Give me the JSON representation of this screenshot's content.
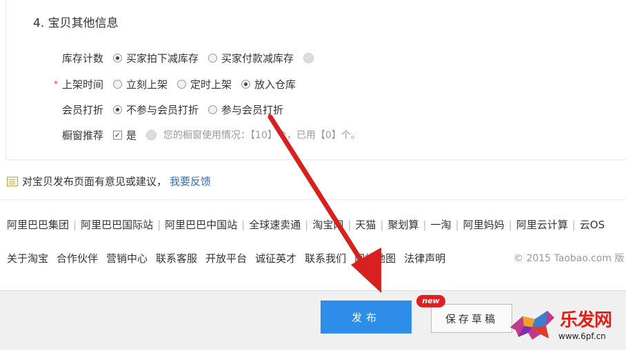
{
  "section": {
    "title": "4. 宝贝其他信息"
  },
  "form": {
    "inventory": {
      "label": "库存计数",
      "opt1": "买家拍下减库存",
      "opt2": "买家付款减库存"
    },
    "listing": {
      "label": "上架时间",
      "opt1": "立刻上架",
      "opt2": "定时上架",
      "opt3": "放入仓库"
    },
    "member": {
      "label": "会员打折",
      "opt1": "不参与会员打折",
      "opt2": "参与会员打折"
    },
    "window": {
      "label": "橱窗推荐",
      "opt1": "是",
      "usage": "您的橱窗使用情况：【10】个，已用【0】个。"
    }
  },
  "feedback": {
    "text": "对宝贝发布页面有意见或建议，",
    "link": "我要反馈"
  },
  "footer_links1": [
    "阿里巴巴集团",
    "阿里巴巴国际站",
    "阿里巴巴中国站",
    "全球速卖通",
    "淘宝网",
    "天猫",
    "聚划算",
    "一淘",
    "阿里妈妈",
    "阿里云计算",
    "云OS"
  ],
  "footer_links2": [
    "关于淘宝",
    "合作伙伴",
    "营销中心",
    "联系客服",
    "开放平台",
    "诚征英才",
    "联系我们",
    "网站地图",
    "法律声明"
  ],
  "copyright": "© 2015 Taobao.com 版",
  "actions": {
    "publish": "发布",
    "draft": "保存草稿",
    "new_badge": "new"
  },
  "watermark": {
    "name": "乐发网",
    "url": "www.6pf.cn"
  },
  "colors": {
    "publish_bg": "#2e8de8",
    "arrow": "#d8201e",
    "badge": "#e02020"
  }
}
